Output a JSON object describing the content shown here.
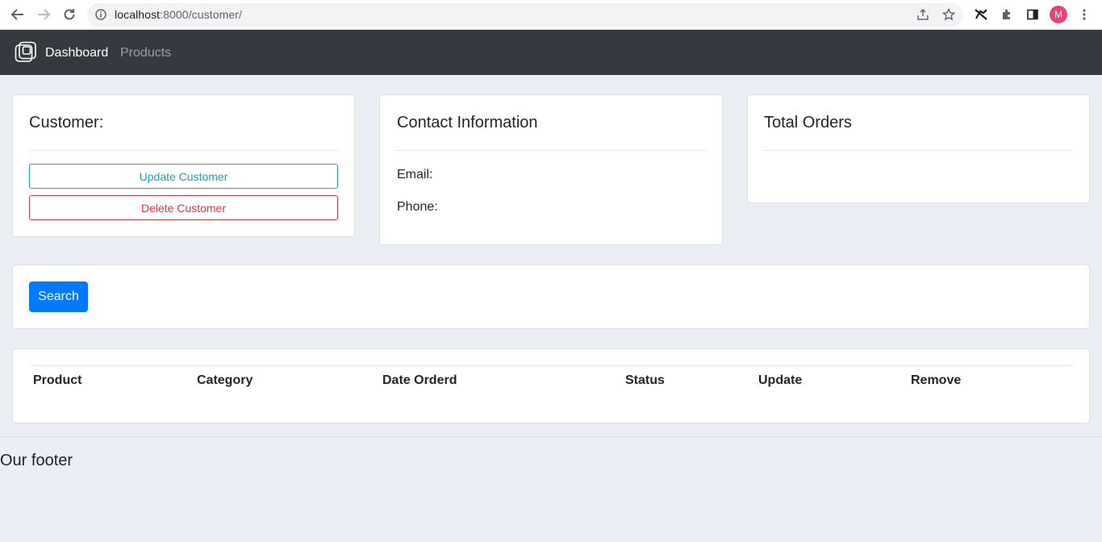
{
  "browser": {
    "url_host": "localhost",
    "url_path": ":8000/customer/",
    "profile_initial": "M"
  },
  "navbar": {
    "links": [
      {
        "label": "Dashboard"
      },
      {
        "label": "Products"
      }
    ]
  },
  "customer_card": {
    "title": "Customer:",
    "update_label": "Update Customer",
    "delete_label": "Delete Customer"
  },
  "contact_card": {
    "title": "Contact Information",
    "email_label": "Email:",
    "phone_label": "Phone:"
  },
  "orders_card": {
    "title": "Total Orders"
  },
  "search": {
    "button_label": "Search"
  },
  "table": {
    "columns": [
      "Product",
      "Category",
      "Date Orderd",
      "Status",
      "Update",
      "Remove"
    ]
  },
  "footer": {
    "text": "Our footer"
  },
  "colors": {
    "navbar": "#343a40",
    "primary": "#007bff",
    "info": "#17a2b8",
    "danger": "#dc3545",
    "page_bg": "#ebeef5"
  }
}
